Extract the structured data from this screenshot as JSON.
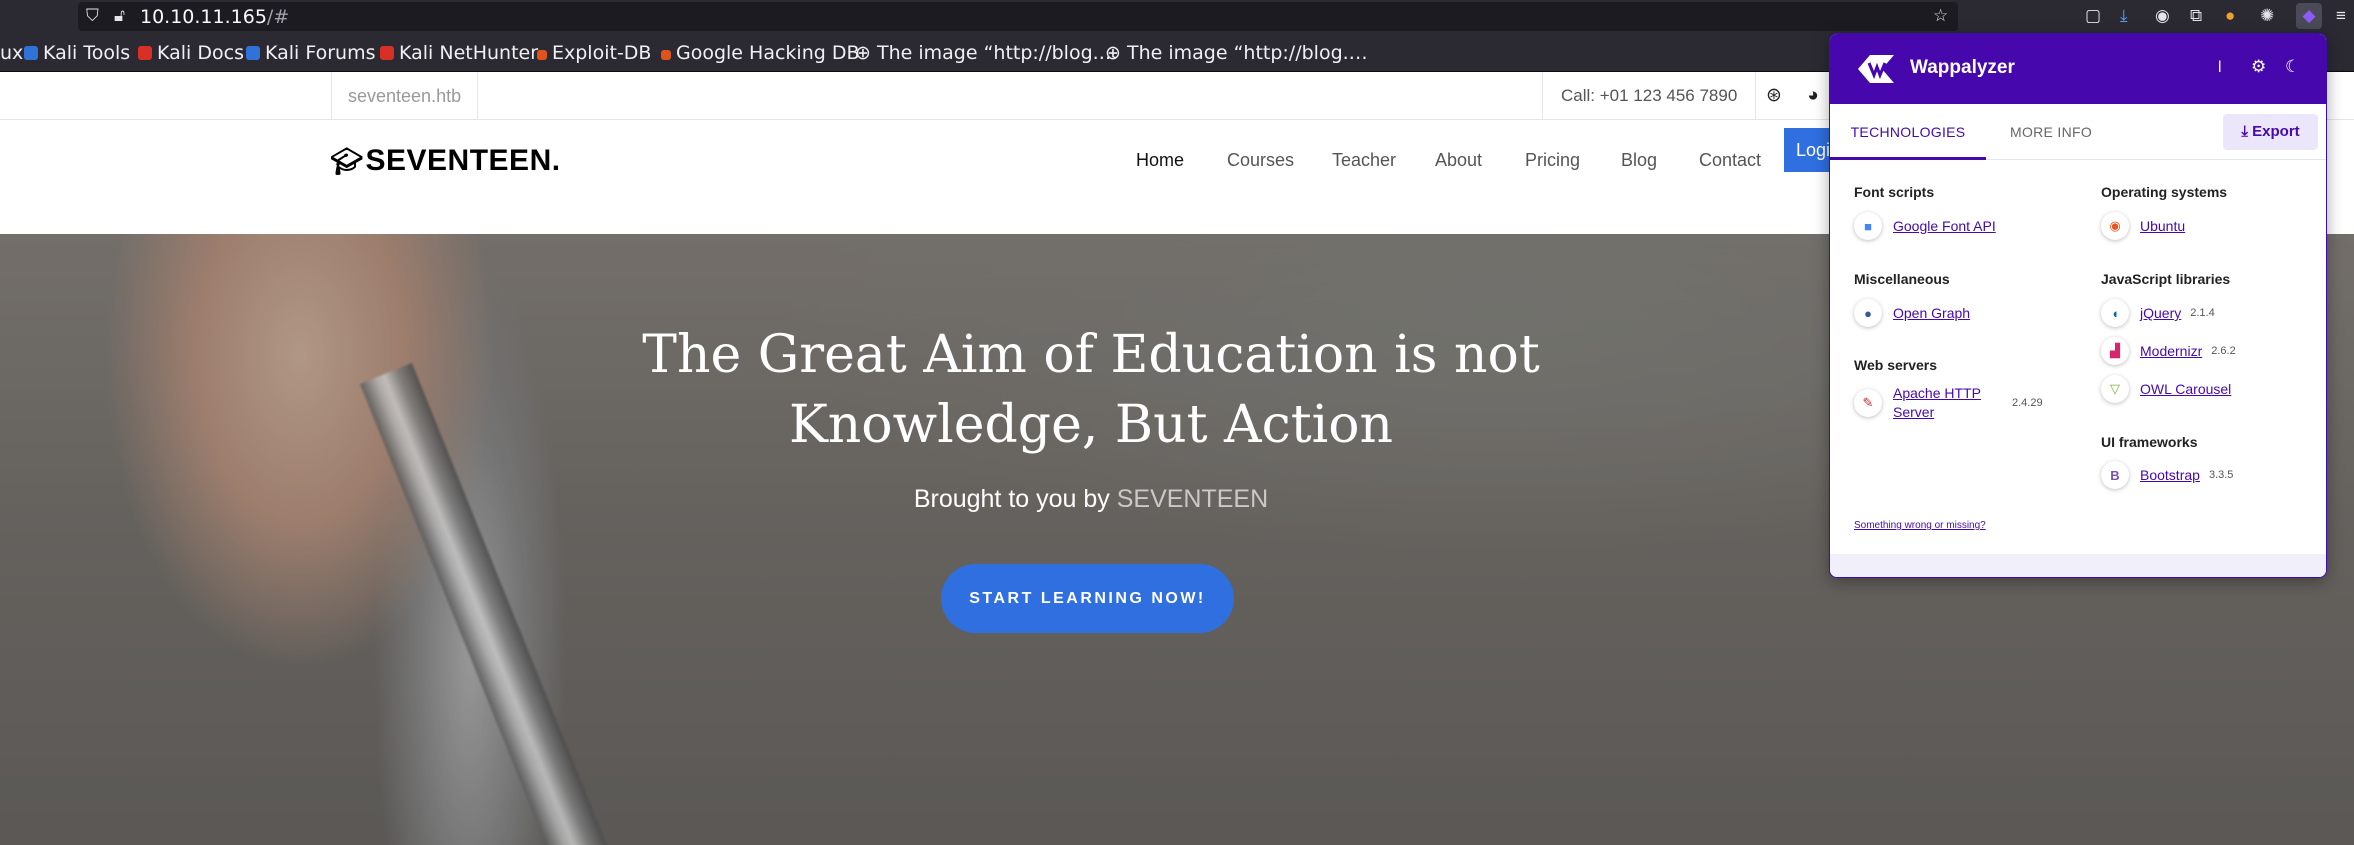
{
  "browser": {
    "url_host": "10.10.11.165",
    "url_rest": "/#",
    "bookmarks": [
      {
        "label": "ux",
        "color": "#2b2a33"
      },
      {
        "label": "Kali Tools",
        "color": "#2f73d9"
      },
      {
        "label": "Kali Docs",
        "color": "#d93025"
      },
      {
        "label": "Kali Forums",
        "color": "#2f73d9"
      },
      {
        "label": "Kali NetHunter",
        "color": "#d93025"
      },
      {
        "label": "Exploit-DB",
        "color": "#e0541c"
      },
      {
        "label": "Google Hacking DB",
        "color": "#e0541c"
      },
      {
        "label": "The image “http://blog.…",
        "color": "#2b2a33"
      },
      {
        "label": "The image “http://blog.…",
        "color": "#2b2a33"
      }
    ]
  },
  "site": {
    "domain": "seventeen.htb",
    "call": "Call: +01 123 456 7890",
    "logo": "SEVENTEEN.",
    "nav": [
      "Home",
      "Courses",
      "Teacher",
      "About",
      "Pricing",
      "Blog",
      "Contact"
    ],
    "login": "Login",
    "hero_title_line1": "The Great Aim of Education is not",
    "hero_title_line2": "Knowledge, But Action",
    "hero_sub_prefix": "Brought to you by",
    "hero_sub_brand": "SEVENTEEN",
    "cta": "START LEARNING NOW!",
    "accent": "#2f6fe0"
  },
  "wappalyzer": {
    "title": "Wappalyzer",
    "tab_technologies": "TECHNOLOGIES",
    "tab_more_info": "MORE INFO",
    "export": "Export",
    "categories": {
      "font_scripts": {
        "name": "Font scripts",
        "tech": [
          {
            "name": "Google Font API",
            "version": ""
          }
        ]
      },
      "misc": {
        "name": "Miscellaneous",
        "tech": [
          {
            "name": "Open Graph",
            "version": ""
          }
        ]
      },
      "web_servers": {
        "name": "Web servers",
        "tech": [
          {
            "name": "Apache HTTP Server",
            "version": "2.4.29"
          }
        ]
      },
      "os": {
        "name": "Operating systems",
        "tech": [
          {
            "name": "Ubuntu",
            "version": ""
          }
        ]
      },
      "js_libs": {
        "name": "JavaScript libraries",
        "tech": [
          {
            "name": "jQuery",
            "version": "2.1.4"
          },
          {
            "name": "Modernizr",
            "version": "2.6.2"
          },
          {
            "name": "OWL Carousel",
            "version": ""
          }
        ]
      },
      "ui": {
        "name": "UI frameworks",
        "tech": [
          {
            "name": "Bootstrap",
            "version": "3.3.5"
          }
        ]
      }
    },
    "wrong": "Something wrong or missing?",
    "brand_color": "#4608ad"
  }
}
